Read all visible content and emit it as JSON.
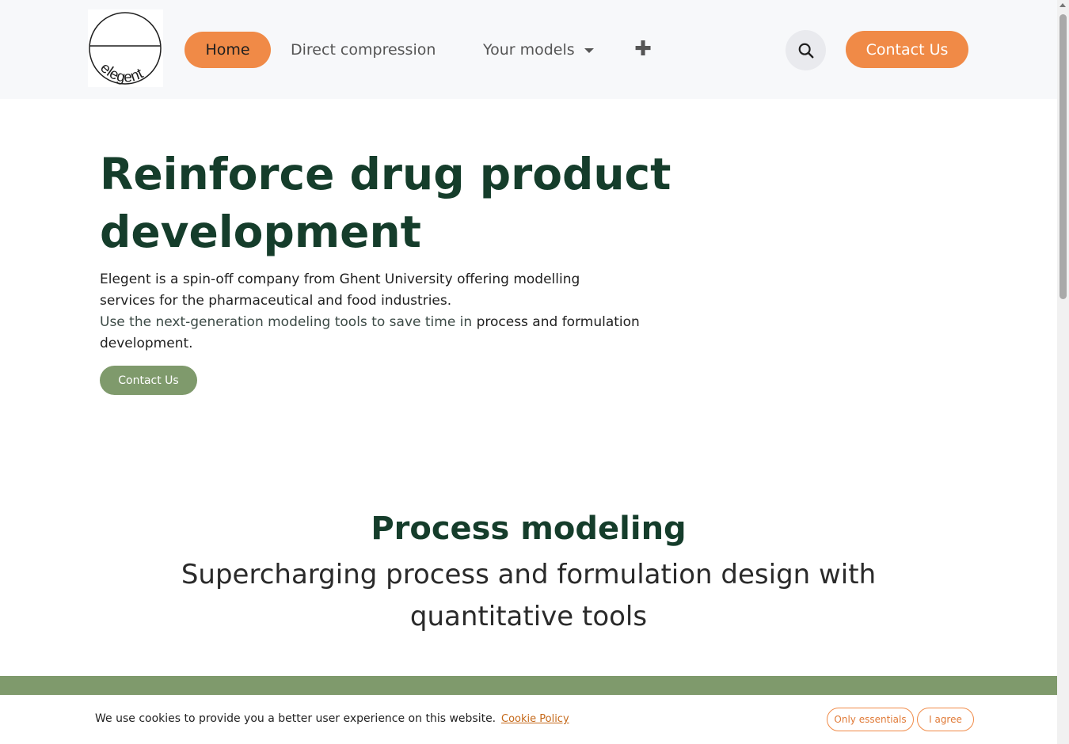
{
  "header": {
    "logo_text": "elegent",
    "nav": {
      "home": "Home",
      "direct_compression": "Direct compression",
      "your_models": "Your models",
      "plus": "✚"
    },
    "search_icon": "search-icon",
    "contact_label": "Contact Us"
  },
  "hero": {
    "title": "Reinforce drug product development",
    "text1": "Elegent is a spin-off company from Ghent University offering modelling services for the pharmaceutical and food industries.",
    "text2_part1": "Use the next-generation modeling tools to save time in ",
    "text2_part2": "process and formulation development",
    "text2_part3": ".",
    "cta_label": "Contact Us"
  },
  "section": {
    "title": "Process modeling",
    "subtitle": "Supercharging process and formulation design with quantitative tools"
  },
  "cookie": {
    "text": "We use cookies to provide you a better user experience on this website.",
    "policy_link": "Cookie Policy",
    "essentials_label": "Only essentials",
    "agree_label": "I agree"
  },
  "colors": {
    "accent_orange": "#f08a47",
    "brand_green": "#7f9a6c",
    "title_green": "#153d2b"
  }
}
